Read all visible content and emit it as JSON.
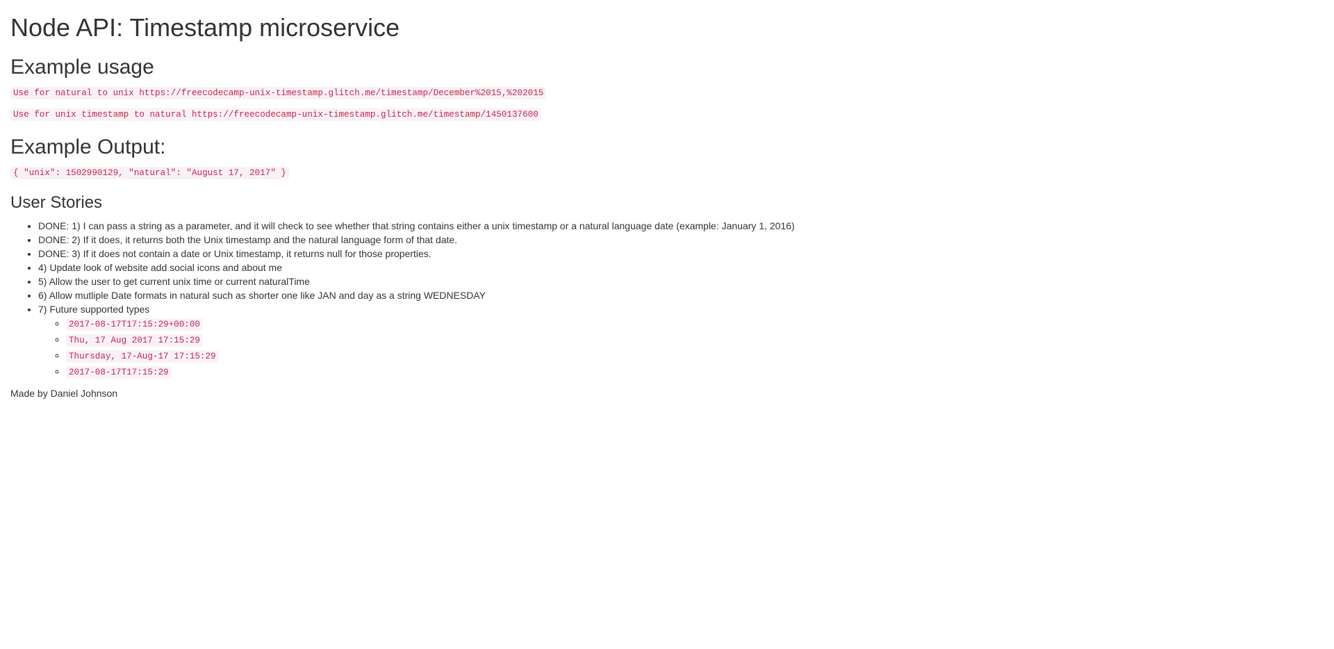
{
  "page": {
    "title": "Node API: Timestamp microservice"
  },
  "example_usage": {
    "heading": "Example usage",
    "items": [
      "Use for natural to unix https://freecodecamp-unix-timestamp.glitch.me/timestamp/December%2015,%202015",
      "Use for unix timestamp to natural https://freecodecamp-unix-timestamp.glitch.me/timestamp/1450137600"
    ]
  },
  "example_output": {
    "heading": "Example Output:",
    "code": "{ \"unix\": 1502990129, \"natural\": \"August 17, 2017\" }"
  },
  "user_stories": {
    "heading": "User Stories",
    "items": [
      "DONE: 1) I can pass a string as a parameter, and it will check to see whether that string contains either a unix timestamp or a natural language date (example: January 1, 2016)",
      "DONE: 2) If it does, it returns both the Unix timestamp and the natural language form of that date.",
      "DONE: 3) If it does not contain a date or Unix timestamp, it returns null for those properties.",
      "4) Update look of website add social icons and about me",
      "5) Allow the user to get current unix time or current naturalTime",
      "6) Allow mutliple Date formats in natural such as shorter one like JAN and day as a string WEDNESDAY",
      "7) Future supported types"
    ],
    "future_types": [
      "2017-08-17T17:15:29+00:00",
      "Thu, 17 Aug 2017 17:15:29",
      "Thursday, 17-Aug-17 17:15:29",
      "2017-08-17T17:15:29"
    ]
  },
  "footer": {
    "text": "Made by Daniel Johnson"
  },
  "colors": {
    "text": "#333333",
    "code_text": "#c7254e",
    "code_background": "#f9f2f4"
  }
}
